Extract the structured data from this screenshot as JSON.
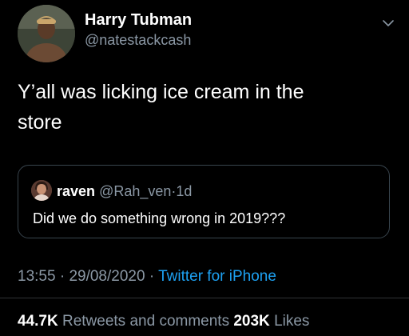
{
  "author": {
    "name": "Harry Tubman",
    "handle": "@natestackcash"
  },
  "tweet": {
    "text_line1": "Y’all was licking ice cream in the",
    "text_line2": "store"
  },
  "quote": {
    "name": "raven",
    "handle": "@Rah_ven",
    "separator": "·",
    "time": "1d",
    "text": "Did we do something wrong in 2019???"
  },
  "meta": {
    "time": "13:55",
    "date": "29/08/2020",
    "separator": "·",
    "source": "Twitter for iPhone"
  },
  "stats": {
    "retweets_count": "44.7K",
    "retweets_label": "Retweets and comments",
    "likes_count": "203K",
    "likes_label": "Likes"
  },
  "icons": {
    "more": "chevron-down-icon"
  },
  "colors": {
    "background": "#000000",
    "primary_text": "#ffffff",
    "secondary_text": "#8b98a5",
    "link": "#1da1f2",
    "border": "#38444d"
  }
}
